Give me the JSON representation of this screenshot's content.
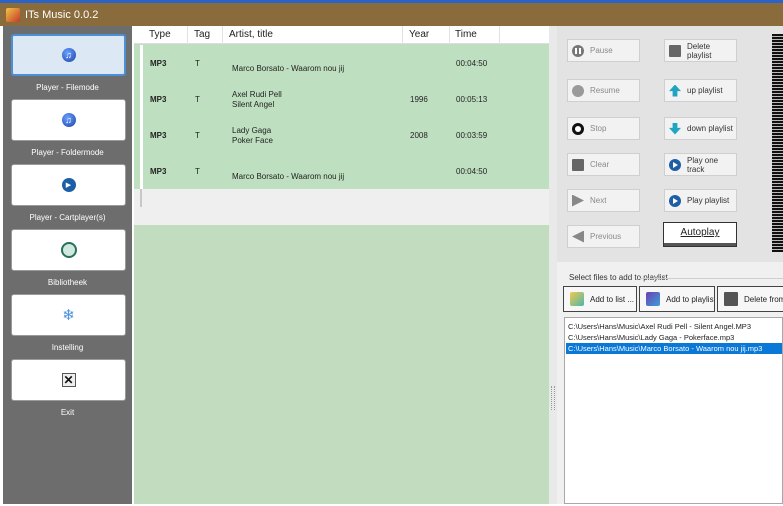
{
  "window": {
    "title": "ITs Music 0.0.2"
  },
  "sidebar": {
    "items": [
      {
        "label": "Player - Filemode",
        "icon": "music-note-icon"
      },
      {
        "label": "Player - Foldermode",
        "icon": "music-note-icon"
      },
      {
        "label": "Player - Cartplayer(s)",
        "icon": "play-icon"
      },
      {
        "label": "Bibliotheek",
        "icon": "globe-icon"
      },
      {
        "label": "Instelling",
        "icon": "gear-icon"
      },
      {
        "label": "Exit",
        "icon": "close-icon"
      }
    ]
  },
  "playlist": {
    "columns": [
      "Type",
      "Tag",
      "Artist, title",
      "Year",
      "Time"
    ],
    "rows": [
      {
        "type": "MP3",
        "tag": "T",
        "artist": "",
        "title": "Marco Borsato - Waarom nou jij",
        "year": "",
        "time": "00:04:50"
      },
      {
        "type": "MP3",
        "tag": "T",
        "artist": "Axel Rudi Pell",
        "title": "Silent Angel",
        "year": "1996",
        "time": "00:05:13"
      },
      {
        "type": "MP3",
        "tag": "T",
        "artist": "Lady Gaga",
        "title": "Poker Face",
        "year": "2008",
        "time": "00:03:59"
      },
      {
        "type": "MP3",
        "tag": "T",
        "artist": "",
        "title": "Marco Borsato - Waarom nou jij",
        "year": "",
        "time": "00:04:50"
      }
    ]
  },
  "controls": {
    "pause": "Pause",
    "resume": "Resume",
    "stop": "Stop",
    "clear": "Clear",
    "next": "Next",
    "previous": "Previous",
    "delete_playlist": "Delete playlist",
    "up_playlist": "up playlist",
    "down_playlist": "down playlist",
    "play_one_track": "Play one track",
    "play_playlist": "Play playlist",
    "autoplay": "Autoplay"
  },
  "add_files": {
    "title": "Select files to add to playlist",
    "add_to_list": "Add to list ...",
    "add_to_playlist": "Add to playlist",
    "delete_from": "Delete from l",
    "files": [
      {
        "path": "C:\\Users\\Hans\\Music\\Axel Rudi Pell - Silent Angel.MP3",
        "selected": false
      },
      {
        "path": "C:\\Users\\Hans\\Music\\Lady Gaga - Pokerface.mp3",
        "selected": false
      },
      {
        "path": "C:\\Users\\Hans\\Music\\Marco Borsato - Waarom nou jij.mp3",
        "selected": true
      }
    ]
  },
  "colors": {
    "sidebar_bg": "#6d6d6d",
    "playlist_bg": "#c2dcc0",
    "active_item": "#dce8f3",
    "selection": "#0a78d7",
    "titlebar": "#8a6b3c"
  }
}
